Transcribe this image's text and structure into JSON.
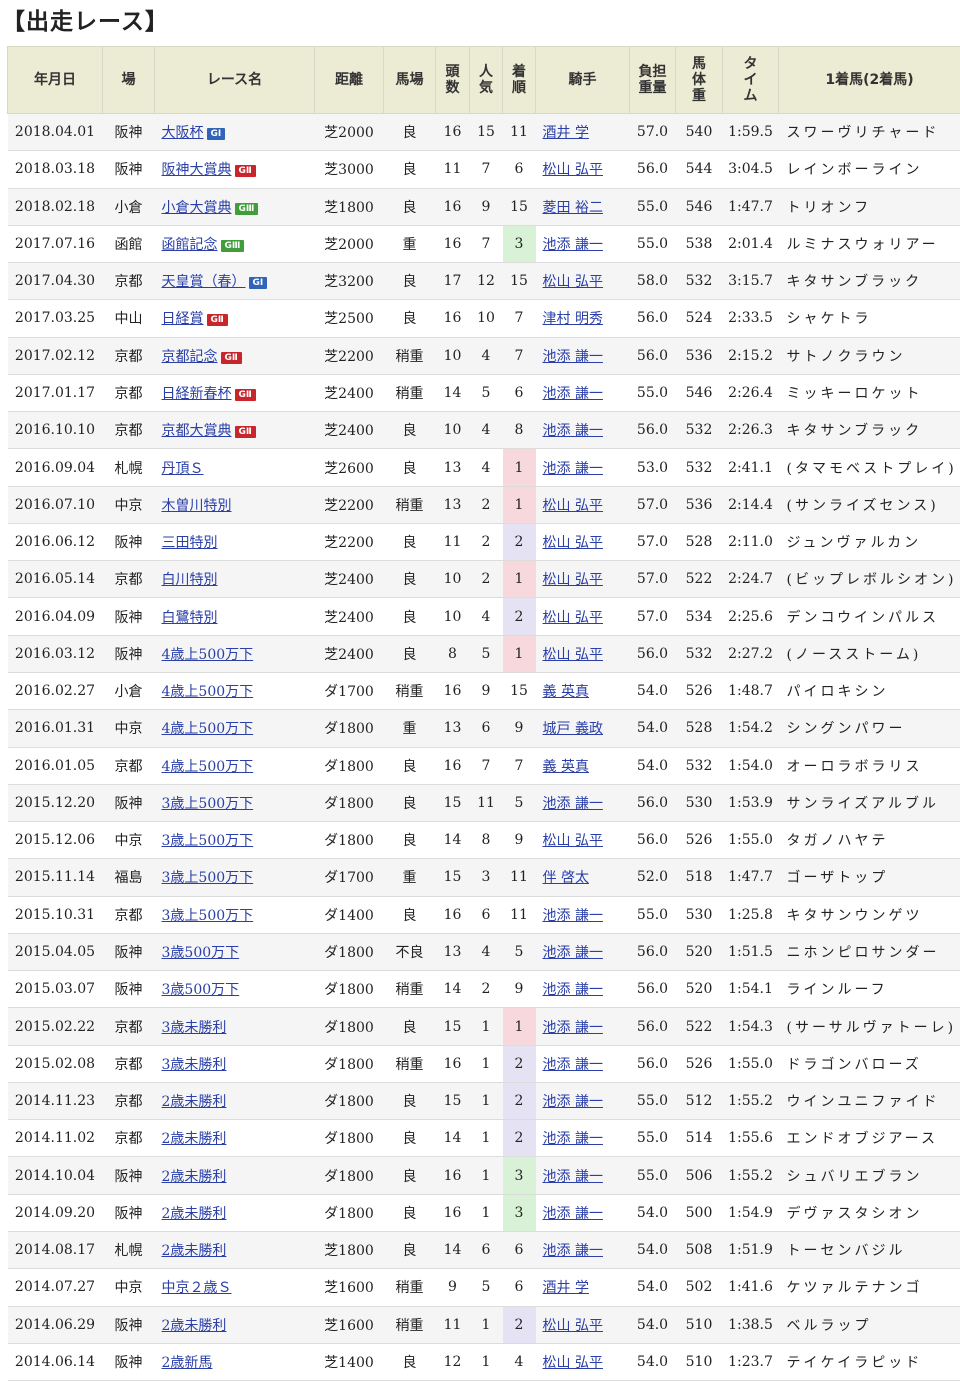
{
  "title": "【出走レース】",
  "headers": {
    "date": "年月日",
    "venue": "場",
    "race": "レース名",
    "distance": "距離",
    "track": "馬場",
    "heads": [
      "頭",
      "数"
    ],
    "pop": [
      "人",
      "気"
    ],
    "rank": [
      "着",
      "順"
    ],
    "jockey": "騎手",
    "weight": [
      "負担",
      "重量"
    ],
    "hw": [
      "馬",
      "体",
      "重"
    ],
    "time": [
      "タ",
      "イ",
      "ム"
    ],
    "winner": "1着馬(2着馬)"
  },
  "rows": [
    {
      "date": "2018.04.01",
      "venue": "阪神",
      "race": "大阪杯",
      "grade": "GⅠ",
      "gclass": "g1",
      "dist": "芝2000",
      "track": "良",
      "heads": "16",
      "pop": "15",
      "rank": "11",
      "rclass": "",
      "jockey": "酒井 学",
      "weight": "57.0",
      "hw": "540",
      "time": "1:59.5",
      "winner": "スワーヴリチャード"
    },
    {
      "date": "2018.03.18",
      "venue": "阪神",
      "race": "阪神大賞典",
      "grade": "GⅡ",
      "gclass": "g2",
      "dist": "芝3000",
      "track": "良",
      "heads": "11",
      "pop": "7",
      "rank": "6",
      "rclass": "",
      "jockey": "松山 弘平",
      "weight": "56.0",
      "hw": "544",
      "time": "3:04.5",
      "winner": "レインボーライン"
    },
    {
      "date": "2018.02.18",
      "venue": "小倉",
      "race": "小倉大賞典",
      "grade": "GⅢ",
      "gclass": "g3",
      "dist": "芝1800",
      "track": "良",
      "heads": "16",
      "pop": "9",
      "rank": "15",
      "rclass": "",
      "jockey": "菱田 裕二",
      "weight": "55.0",
      "hw": "546",
      "time": "1:47.7",
      "winner": "トリオンフ"
    },
    {
      "date": "2017.07.16",
      "venue": "函館",
      "race": "函館記念",
      "grade": "GⅢ",
      "gclass": "g3",
      "dist": "芝2000",
      "track": "重",
      "heads": "16",
      "pop": "7",
      "rank": "3",
      "rclass": "r3",
      "jockey": "池添 謙一",
      "weight": "55.0",
      "hw": "538",
      "time": "2:01.4",
      "winner": "ルミナスウォリアー"
    },
    {
      "date": "2017.04.30",
      "venue": "京都",
      "race": "天皇賞（春）",
      "grade": "GⅠ",
      "gclass": "g1",
      "dist": "芝3200",
      "track": "良",
      "heads": "17",
      "pop": "12",
      "rank": "15",
      "rclass": "",
      "jockey": "松山 弘平",
      "weight": "58.0",
      "hw": "532",
      "time": "3:15.7",
      "winner": "キタサンブラック"
    },
    {
      "date": "2017.03.25",
      "venue": "中山",
      "race": "日経賞",
      "grade": "GⅡ",
      "gclass": "g2",
      "dist": "芝2500",
      "track": "良",
      "heads": "16",
      "pop": "10",
      "rank": "7",
      "rclass": "",
      "jockey": "津村 明秀",
      "weight": "56.0",
      "hw": "524",
      "time": "2:33.5",
      "winner": "シャケトラ"
    },
    {
      "date": "2017.02.12",
      "venue": "京都",
      "race": "京都記念",
      "grade": "GⅡ",
      "gclass": "g2",
      "dist": "芝2200",
      "track": "稍重",
      "heads": "10",
      "pop": "4",
      "rank": "7",
      "rclass": "",
      "jockey": "池添 謙一",
      "weight": "56.0",
      "hw": "536",
      "time": "2:15.2",
      "winner": "サトノクラウン"
    },
    {
      "date": "2017.01.17",
      "venue": "京都",
      "race": "日経新春杯",
      "grade": "GⅡ",
      "gclass": "g2",
      "dist": "芝2400",
      "track": "稍重",
      "heads": "14",
      "pop": "5",
      "rank": "6",
      "rclass": "",
      "jockey": "池添 謙一",
      "weight": "55.0",
      "hw": "546",
      "time": "2:26.4",
      "winner": "ミッキーロケット"
    },
    {
      "date": "2016.10.10",
      "venue": "京都",
      "race": "京都大賞典",
      "grade": "GⅡ",
      "gclass": "g2",
      "dist": "芝2400",
      "track": "良",
      "heads": "10",
      "pop": "4",
      "rank": "8",
      "rclass": "",
      "jockey": "池添 謙一",
      "weight": "56.0",
      "hw": "532",
      "time": "2:26.3",
      "winner": "キタサンブラック"
    },
    {
      "date": "2016.09.04",
      "venue": "札幌",
      "race": "丹頂Ｓ",
      "grade": "",
      "gclass": "",
      "dist": "芝2600",
      "track": "良",
      "heads": "13",
      "pop": "4",
      "rank": "1",
      "rclass": "r1",
      "jockey": "池添 謙一",
      "weight": "53.0",
      "hw": "532",
      "time": "2:41.1",
      "winner": "(タマモベストプレイ)"
    },
    {
      "date": "2016.07.10",
      "venue": "中京",
      "race": "木曽川特別",
      "grade": "",
      "gclass": "",
      "dist": "芝2200",
      "track": "稍重",
      "heads": "13",
      "pop": "2",
      "rank": "1",
      "rclass": "r1",
      "jockey": "松山 弘平",
      "weight": "57.0",
      "hw": "536",
      "time": "2:14.4",
      "winner": "(サンライズセンス)"
    },
    {
      "date": "2016.06.12",
      "venue": "阪神",
      "race": "三田特別",
      "grade": "",
      "gclass": "",
      "dist": "芝2200",
      "track": "良",
      "heads": "11",
      "pop": "2",
      "rank": "2",
      "rclass": "r2",
      "jockey": "松山 弘平",
      "weight": "57.0",
      "hw": "528",
      "time": "2:11.0",
      "winner": "ジュンヴァルカン"
    },
    {
      "date": "2016.05.14",
      "venue": "京都",
      "race": "白川特別",
      "grade": "",
      "gclass": "",
      "dist": "芝2400",
      "track": "良",
      "heads": "10",
      "pop": "2",
      "rank": "1",
      "rclass": "r1",
      "jockey": "松山 弘平",
      "weight": "57.0",
      "hw": "522",
      "time": "2:24.7",
      "winner": "(ビップレボルシオン)"
    },
    {
      "date": "2016.04.09",
      "venue": "阪神",
      "race": "白鷺特別",
      "grade": "",
      "gclass": "",
      "dist": "芝2400",
      "track": "良",
      "heads": "10",
      "pop": "4",
      "rank": "2",
      "rclass": "r2",
      "jockey": "松山 弘平",
      "weight": "57.0",
      "hw": "534",
      "time": "2:25.6",
      "winner": "デンコウインパルス"
    },
    {
      "date": "2016.03.12",
      "venue": "阪神",
      "race": "4歳上500万下",
      "grade": "",
      "gclass": "",
      "dist": "芝2400",
      "track": "良",
      "heads": "8",
      "pop": "5",
      "rank": "1",
      "rclass": "r1",
      "jockey": "松山 弘平",
      "weight": "56.0",
      "hw": "532",
      "time": "2:27.2",
      "winner": "(ノースストーム)"
    },
    {
      "date": "2016.02.27",
      "venue": "小倉",
      "race": "4歳上500万下",
      "grade": "",
      "gclass": "",
      "dist": "ダ1700",
      "track": "稍重",
      "heads": "16",
      "pop": "9",
      "rank": "15",
      "rclass": "",
      "jockey": "義 英真",
      "weight": "54.0",
      "hw": "526",
      "time": "1:48.7",
      "winner": "パイロキシン"
    },
    {
      "date": "2016.01.31",
      "venue": "中京",
      "race": "4歳上500万下",
      "grade": "",
      "gclass": "",
      "dist": "ダ1800",
      "track": "重",
      "heads": "13",
      "pop": "6",
      "rank": "9",
      "rclass": "",
      "jockey": "城戸 義政",
      "weight": "54.0",
      "hw": "528",
      "time": "1:54.2",
      "winner": "シングンパワー"
    },
    {
      "date": "2016.01.05",
      "venue": "京都",
      "race": "4歳上500万下",
      "grade": "",
      "gclass": "",
      "dist": "ダ1800",
      "track": "良",
      "heads": "16",
      "pop": "7",
      "rank": "7",
      "rclass": "",
      "jockey": "義 英真",
      "weight": "54.0",
      "hw": "532",
      "time": "1:54.0",
      "winner": "オーロラボラリス"
    },
    {
      "date": "2015.12.20",
      "venue": "阪神",
      "race": "3歳上500万下",
      "grade": "",
      "gclass": "",
      "dist": "ダ1800",
      "track": "良",
      "heads": "15",
      "pop": "11",
      "rank": "5",
      "rclass": "",
      "jockey": "池添 謙一",
      "weight": "56.0",
      "hw": "530",
      "time": "1:53.9",
      "winner": "サンライズアルブル"
    },
    {
      "date": "2015.12.06",
      "venue": "中京",
      "race": "3歳上500万下",
      "grade": "",
      "gclass": "",
      "dist": "ダ1800",
      "track": "良",
      "heads": "14",
      "pop": "8",
      "rank": "9",
      "rclass": "",
      "jockey": "松山 弘平",
      "weight": "56.0",
      "hw": "526",
      "time": "1:55.0",
      "winner": "タガノハヤテ"
    },
    {
      "date": "2015.11.14",
      "venue": "福島",
      "race": "3歳上500万下",
      "grade": "",
      "gclass": "",
      "dist": "ダ1700",
      "track": "重",
      "heads": "15",
      "pop": "3",
      "rank": "11",
      "rclass": "",
      "jockey": "伴 啓太",
      "weight": "52.0",
      "hw": "518",
      "time": "1:47.7",
      "winner": "ゴーザトップ"
    },
    {
      "date": "2015.10.31",
      "venue": "京都",
      "race": "3歳上500万下",
      "grade": "",
      "gclass": "",
      "dist": "ダ1400",
      "track": "良",
      "heads": "16",
      "pop": "6",
      "rank": "11",
      "rclass": "",
      "jockey": "池添 謙一",
      "weight": "55.0",
      "hw": "530",
      "time": "1:25.8",
      "winner": "キタサンウンゲツ"
    },
    {
      "date": "2015.04.05",
      "venue": "阪神",
      "race": "3歳500万下",
      "grade": "",
      "gclass": "",
      "dist": "ダ1800",
      "track": "不良",
      "heads": "13",
      "pop": "4",
      "rank": "5",
      "rclass": "",
      "jockey": "池添 謙一",
      "weight": "56.0",
      "hw": "520",
      "time": "1:51.5",
      "winner": "ニホンピロサンダー"
    },
    {
      "date": "2015.03.07",
      "venue": "阪神",
      "race": "3歳500万下",
      "grade": "",
      "gclass": "",
      "dist": "ダ1800",
      "track": "稍重",
      "heads": "14",
      "pop": "2",
      "rank": "9",
      "rclass": "",
      "jockey": "池添 謙一",
      "weight": "56.0",
      "hw": "520",
      "time": "1:54.1",
      "winner": "ラインルーフ"
    },
    {
      "date": "2015.02.22",
      "venue": "京都",
      "race": "3歳未勝利",
      "grade": "",
      "gclass": "",
      "dist": "ダ1800",
      "track": "良",
      "heads": "15",
      "pop": "1",
      "rank": "1",
      "rclass": "r1",
      "jockey": "池添 謙一",
      "weight": "56.0",
      "hw": "522",
      "time": "1:54.3",
      "winner": "(サーサルヴァトーレ)"
    },
    {
      "date": "2015.02.08",
      "venue": "京都",
      "race": "3歳未勝利",
      "grade": "",
      "gclass": "",
      "dist": "ダ1800",
      "track": "稍重",
      "heads": "16",
      "pop": "1",
      "rank": "2",
      "rclass": "r2",
      "jockey": "池添 謙一",
      "weight": "56.0",
      "hw": "526",
      "time": "1:55.0",
      "winner": "ドラゴンバローズ"
    },
    {
      "date": "2014.11.23",
      "venue": "京都",
      "race": "2歳未勝利",
      "grade": "",
      "gclass": "",
      "dist": "ダ1800",
      "track": "良",
      "heads": "15",
      "pop": "1",
      "rank": "2",
      "rclass": "r2",
      "jockey": "池添 謙一",
      "weight": "55.0",
      "hw": "512",
      "time": "1:55.2",
      "winner": "ウインユニファイド"
    },
    {
      "date": "2014.11.02",
      "venue": "京都",
      "race": "2歳未勝利",
      "grade": "",
      "gclass": "",
      "dist": "ダ1800",
      "track": "良",
      "heads": "14",
      "pop": "1",
      "rank": "2",
      "rclass": "r2",
      "jockey": "池添 謙一",
      "weight": "55.0",
      "hw": "514",
      "time": "1:55.6",
      "winner": "エンドオブジアース"
    },
    {
      "date": "2014.10.04",
      "venue": "阪神",
      "race": "2歳未勝利",
      "grade": "",
      "gclass": "",
      "dist": "ダ1800",
      "track": "良",
      "heads": "16",
      "pop": "1",
      "rank": "3",
      "rclass": "r3",
      "jockey": "池添 謙一",
      "weight": "55.0",
      "hw": "506",
      "time": "1:55.2",
      "winner": "シュバリエブラン"
    },
    {
      "date": "2014.09.20",
      "venue": "阪神",
      "race": "2歳未勝利",
      "grade": "",
      "gclass": "",
      "dist": "ダ1800",
      "track": "良",
      "heads": "16",
      "pop": "1",
      "rank": "3",
      "rclass": "r3",
      "jockey": "池添 謙一",
      "weight": "54.0",
      "hw": "500",
      "time": "1:54.9",
      "winner": "デヴァスタシオン"
    },
    {
      "date": "2014.08.17",
      "venue": "札幌",
      "race": "2歳未勝利",
      "grade": "",
      "gclass": "",
      "dist": "芝1800",
      "track": "良",
      "heads": "14",
      "pop": "6",
      "rank": "6",
      "rclass": "",
      "jockey": "池添 謙一",
      "weight": "54.0",
      "hw": "508",
      "time": "1:51.9",
      "winner": "トーセンバジル"
    },
    {
      "date": "2014.07.27",
      "venue": "中京",
      "race": "中京２歳Ｓ",
      "grade": "",
      "gclass": "",
      "dist": "芝1600",
      "track": "稍重",
      "heads": "9",
      "pop": "5",
      "rank": "6",
      "rclass": "",
      "jockey": "酒井 学",
      "weight": "54.0",
      "hw": "502",
      "time": "1:41.6",
      "winner": "ケツァルテナンゴ"
    },
    {
      "date": "2014.06.29",
      "venue": "阪神",
      "race": "2歳未勝利",
      "grade": "",
      "gclass": "",
      "dist": "芝1600",
      "track": "稍重",
      "heads": "11",
      "pop": "1",
      "rank": "2",
      "rclass": "r2",
      "jockey": "松山 弘平",
      "weight": "54.0",
      "hw": "510",
      "time": "1:38.5",
      "winner": "ベルラップ"
    },
    {
      "date": "2014.06.14",
      "venue": "阪神",
      "race": "2歳新馬",
      "grade": "",
      "gclass": "",
      "dist": "芝1400",
      "track": "良",
      "heads": "12",
      "pop": "1",
      "rank": "4",
      "rclass": "",
      "jockey": "松山 弘平",
      "weight": "54.0",
      "hw": "510",
      "time": "1:23.7",
      "winner": "テイケイラピッド"
    }
  ]
}
